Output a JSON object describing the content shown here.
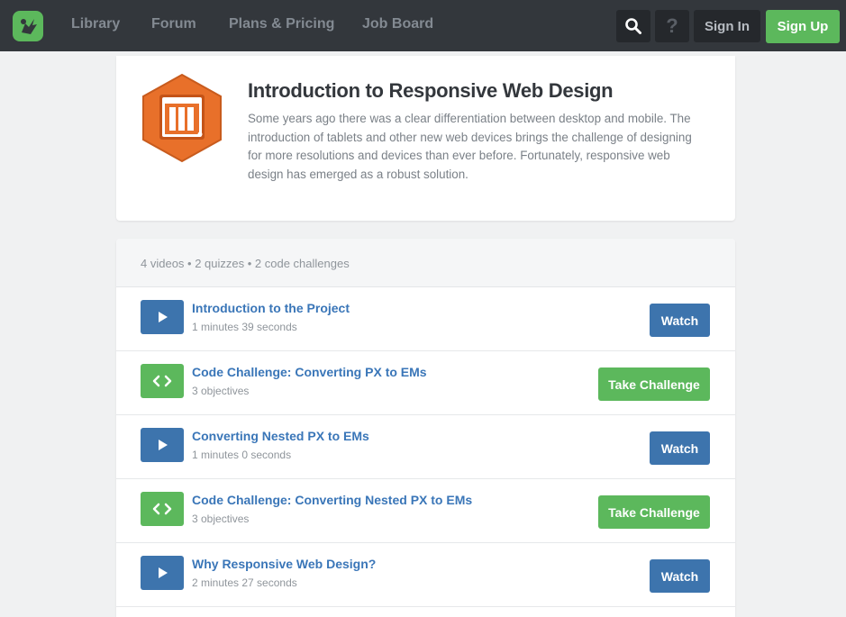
{
  "nav": {
    "logo_icon": "treehouse-logo-icon",
    "links": [
      "Library",
      "Forum",
      "Plans & Pricing",
      "Job Board"
    ],
    "search_icon": "search-icon",
    "help_icon": "help-icon",
    "help_glyph": "?",
    "sign_in": "Sign In",
    "sign_up": "Sign Up"
  },
  "course": {
    "badge_icon": "responsive-design-badge-icon",
    "title": "Introduction to Responsive Web Design",
    "description": "Some years ago there was a clear differentiation between desktop and mobile. The introduction of tablets and other new web devices brings the challenge of designing for more resolutions and devices than ever before. Fortunately, responsive web design has emerged as a robust solution."
  },
  "steps": {
    "summary": "4 videos • 2 quizzes • 2 code challenges",
    "items": [
      {
        "type": "video",
        "icon": "play-icon",
        "title": "Introduction to the Project",
        "meta": "1 minutes 39 seconds",
        "action": "Watch"
      },
      {
        "type": "code",
        "icon": "code-icon",
        "title": "Code Challenge: Converting PX to EMs",
        "meta": "3 objectives",
        "action": "Take Challenge"
      },
      {
        "type": "video",
        "icon": "play-icon",
        "title": "Converting Nested PX to EMs",
        "meta": "1 minutes 0 seconds",
        "action": "Watch"
      },
      {
        "type": "code",
        "icon": "code-icon",
        "title": "Code Challenge: Converting Nested PX to EMs",
        "meta": "3 objectives",
        "action": "Take Challenge"
      },
      {
        "type": "video",
        "icon": "play-icon",
        "title": "Why Responsive Web Design?",
        "meta": "2 minutes 27 seconds",
        "action": "Watch"
      }
    ]
  },
  "colors": {
    "nav_bg": "#33373c",
    "brand_green": "#5cb85c",
    "video_blue": "#3d74ad",
    "link_blue": "#3a76b8",
    "badge_orange": "#e8702a"
  }
}
